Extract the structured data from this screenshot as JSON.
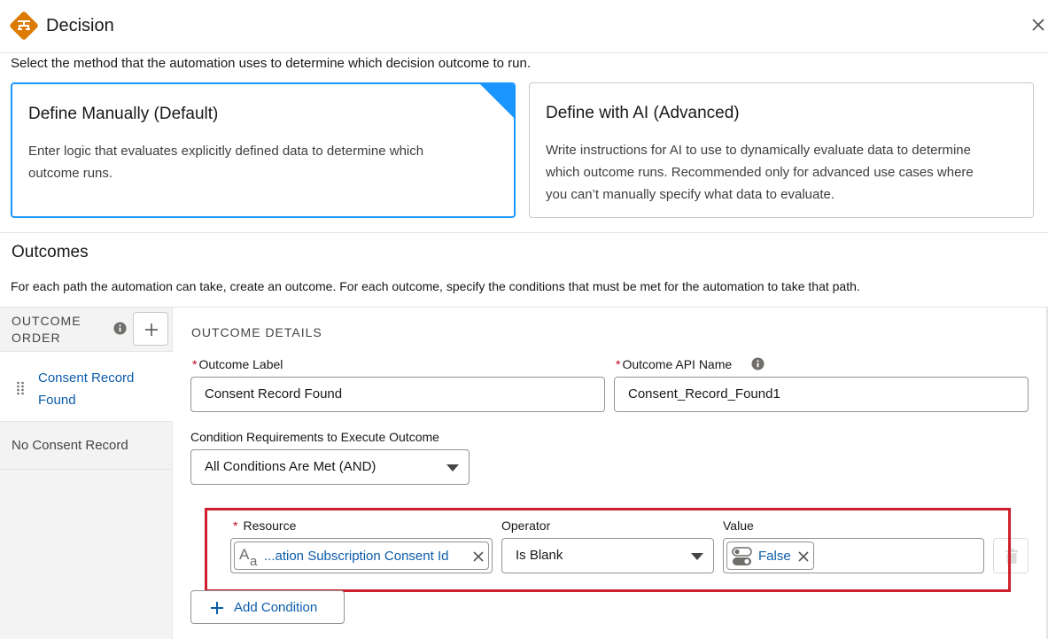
{
  "header": {
    "title": "Decision",
    "logo_color": "#dd7a01"
  },
  "intro_text": "Select the method that the automation uses to determine which decision outcome to run.",
  "methods": [
    {
      "title": "Define Manually (Default)",
      "description_lines": [
        "Enter logic that evaluates explicitly defined data to determine which",
        "outcome runs."
      ],
      "selected": true
    },
    {
      "title": "Define with AI (Advanced)",
      "description_lines": [
        "Write instructions for AI to use to dynamically evaluate data to determine",
        "which outcome runs. Recommended only for advanced use cases where",
        "you can’t manually specify what data to evaluate."
      ],
      "selected": false
    }
  ],
  "outcomes": {
    "heading": "Outcomes",
    "description": "For each path the automation can take, create an outcome. For each outcome, specify the conditions that must be met for the automation to take that path.",
    "order_label_line1": "OUTCOME",
    "order_label_line2": "ORDER",
    "items": [
      {
        "label_line1": "Consent Record",
        "label_line2": "Found",
        "active": true
      },
      {
        "label": "No Consent Record",
        "active": false
      }
    ]
  },
  "details": {
    "heading": "OUTCOME DETAILS",
    "outcome_label_label": "Outcome Label",
    "outcome_label_value": "Consent Record Found",
    "api_name_label": "Outcome API Name",
    "api_name_value": "Consent_Record_Found1",
    "condition_req_label": "Condition Requirements to Execute Outcome",
    "condition_req_value": "All Conditions Are Met (AND)",
    "condition": {
      "resource_label": "Resource",
      "resource_value": "...ation Subscription Consent Id",
      "resource_icon": "text-type-icon",
      "operator_label": "Operator",
      "operator_value": "Is Blank",
      "value_label": "Value",
      "value_value": "False",
      "value_icon": "boolean-toggle-icon"
    },
    "add_condition_label": "Add Condition"
  },
  "colors": {
    "accent": "#1b96ff",
    "link": "#0b5cab",
    "highlight": "#d0202e",
    "required": "#ba0517"
  }
}
